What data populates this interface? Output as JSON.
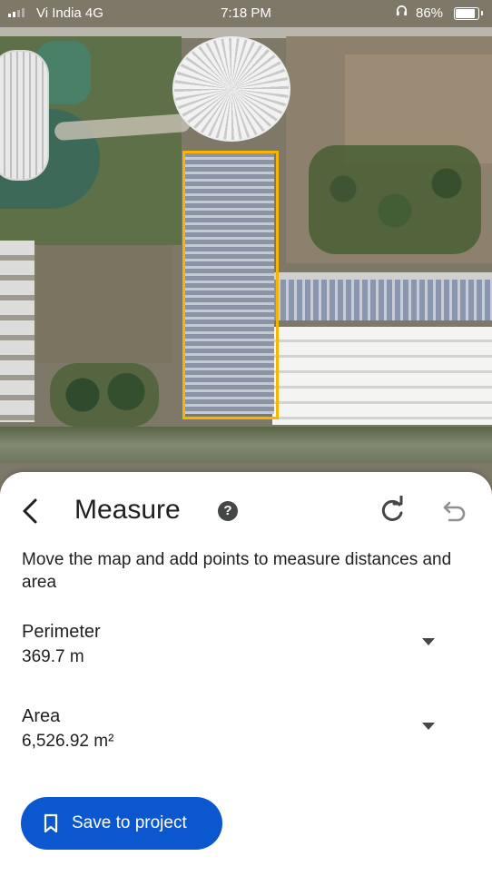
{
  "status_bar": {
    "carrier": "Vi India  4G",
    "time": "7:18 PM",
    "battery": "86%"
  },
  "map": {
    "measure_outline_color": "#f7b500"
  },
  "sheet": {
    "title": "Measure",
    "help_icon_glyph": "?",
    "description": "Move the map and add points to measure distances and area",
    "perimeter": {
      "label": "Perimeter",
      "value": "369.7 m"
    },
    "area": {
      "label": "Area",
      "value": "6,526.92 m²"
    },
    "save_button": {
      "label": "Save to project"
    }
  },
  "colors": {
    "accent": "#0b57d0",
    "icon": "#444746",
    "text": "#1f1f1f"
  }
}
